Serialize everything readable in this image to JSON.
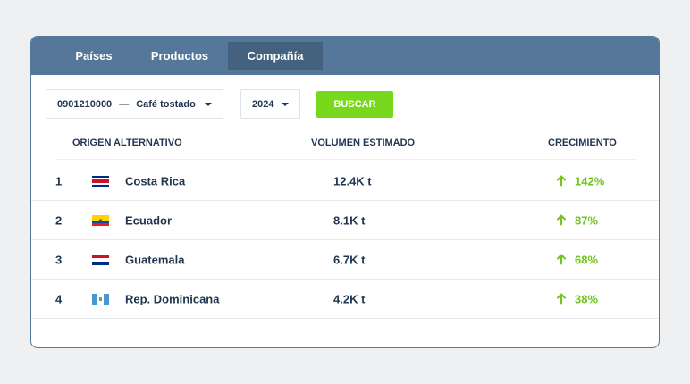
{
  "tabs": [
    {
      "label": "Países"
    },
    {
      "label": "Productos"
    },
    {
      "label": "Compañía"
    }
  ],
  "filters": {
    "product_code": "0901210000",
    "product_sep": "—",
    "product_name": "Café tostado",
    "year": "2024",
    "search_label": "BUSCAR"
  },
  "table": {
    "headers": {
      "origin": "ORIGEN ALTERNATIVO",
      "volume": "VOLUMEN ESTIMADO",
      "growth": "CRECIMIENTO"
    },
    "rows": [
      {
        "rank": "1",
        "flag": "costa-rica-flag",
        "country": "Costa Rica",
        "volume": "12.4K t",
        "growth": "142%"
      },
      {
        "rank": "2",
        "flag": "ecuador-flag",
        "country": "Ecuador",
        "volume": "8.1K t",
        "growth": "87%"
      },
      {
        "rank": "3",
        "flag": "guatemala-flag",
        "country": "Guatemala",
        "volume": "6.7K t",
        "growth": "68%"
      },
      {
        "rank": "4",
        "flag": "dominican-republic-flag",
        "country": "Rep. Dominicana",
        "volume": "4.2K t",
        "growth": "38%"
      }
    ]
  },
  "colors": {
    "header_bg": "#54779a",
    "active_tab_bg": "#44627f",
    "button_bg": "#77d81c",
    "growth_text": "#72c51e",
    "text": "#1f3550"
  },
  "icons": {
    "select_caret": "chevron-down-icon",
    "growth_arrow": "arrow-up-icon"
  }
}
